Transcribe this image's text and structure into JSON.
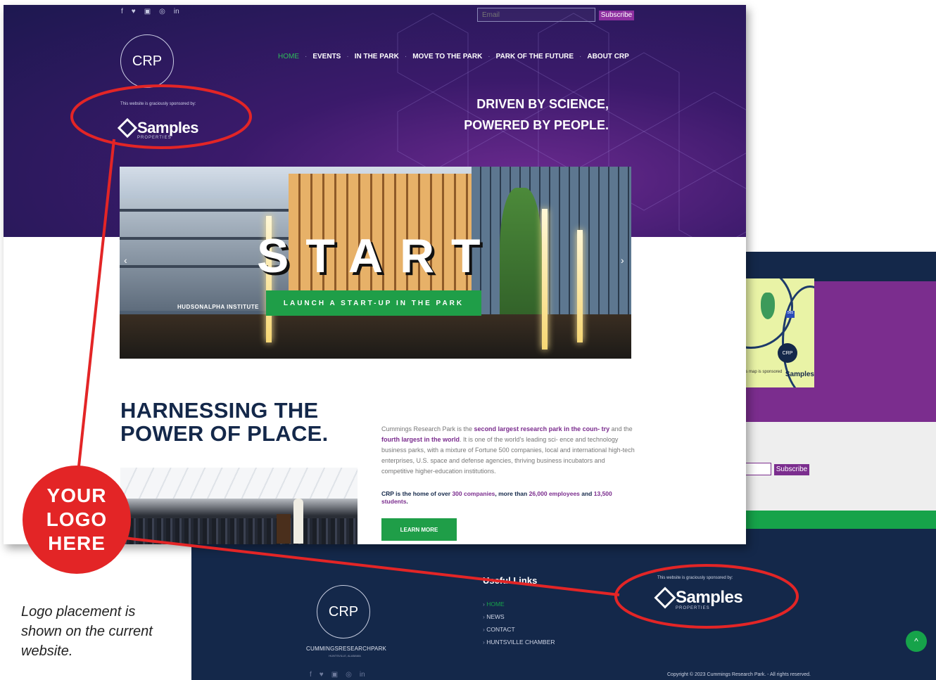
{
  "front": {
    "social_icons": [
      "f",
      "t",
      "y",
      "ig",
      "in"
    ],
    "email_placeholder": "Email",
    "subscribe_label": "Subscribe",
    "logo_text": "CRP",
    "nav": [
      {
        "label": "HOME",
        "active": true
      },
      {
        "label": "EVENTS",
        "active": false
      },
      {
        "label": "IN THE PARK",
        "active": false
      },
      {
        "label": "MOVE TO THE PARK",
        "active": false
      },
      {
        "label": "PARK OF THE FUTURE",
        "active": false
      },
      {
        "label": "ABOUT CRP",
        "active": false
      }
    ],
    "sponsor_text": "This website is graciously sponsored by:",
    "sponsor_name": "Samples",
    "sponsor_sub": "PROPERTIES",
    "tagline_line1": "DRIVEN BY SCIENCE,",
    "tagline_line2": "POWERED BY PEOPLE.",
    "slider": {
      "headline": "START",
      "cta": "LAUNCH A START-UP IN THE PARK",
      "institute_sign": "HUDSONALPHA INSTITUTE"
    },
    "heading_line1": "HARNESSING THE",
    "heading_line2": "POWER OF PLACE.",
    "paragraph": {
      "p1": "Cummings Research Park is the ",
      "h1": "second largest research park in the coun- try",
      "p2": " and the ",
      "h2": "fourth largest in the world",
      "p3": ". It is one of the world's leading sci- ence and technology business parks, with a mixture of Fortune 500 companies, local and international high-tech enterprises, U.S. space and defense agencies, thriving business incubators and competitive higher-education institutions."
    },
    "paragraph2": {
      "p1": "CRP is the home of over ",
      "h1": "300 companies",
      "p2": ", more than ",
      "h2": "26,000 employees",
      "p3": " and ",
      "h3": "13,500 students",
      "p4": "."
    },
    "learn_more": "LEARN MORE"
  },
  "back": {
    "map_logo": "CRP",
    "map_shield": "565",
    "map_sponsor_text": "This map is sponsored by",
    "map_sponsor_name": "Samples",
    "subscribe_label": "Subscribe",
    "footer_logo": "CRP",
    "footer_name": "CUMMINGSRESEARCHPARK",
    "footer_city": "HUNTSVILLE, ALABAMA",
    "useful_links_title": "Useful Links",
    "useful_links": [
      "HOME",
      "NEWS",
      "CONTACT",
      "HUNTSVILLE CHAMBER"
    ],
    "sponsor_text": "This website is graciously sponsored by:",
    "sponsor_name": "Samples",
    "sponsor_sub": "PROPERTIES",
    "social_icons": [
      "f",
      "t",
      "y",
      "ig",
      "in"
    ],
    "copyright": "Copyright © 2023 Cummings Research Park. - All rights reserved.",
    "to_top": "^"
  },
  "annotation": {
    "badge_line1": "YOUR",
    "badge_line2": "LOGO",
    "badge_line3": "HERE",
    "caption": "Logo placement is shown on the current website.",
    "accent_color": "#e32526"
  }
}
